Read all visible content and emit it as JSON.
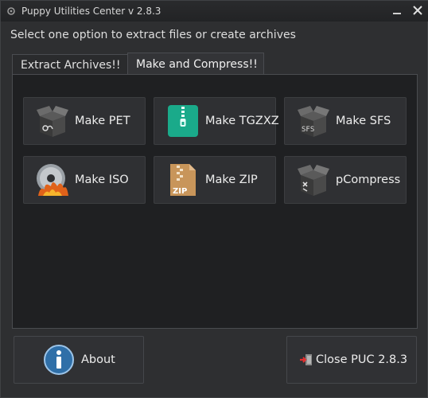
{
  "window": {
    "title": "Puppy Utilities Center v 2.8.3",
    "controls": [
      "minimize-icon",
      "close-icon"
    ]
  },
  "instruction": "Select one option to extract files or create archives",
  "tabs": [
    {
      "label": "Extract Archives!!",
      "active": false
    },
    {
      "label": "Make and Compress!!",
      "active": true
    }
  ],
  "buttons": {
    "make_pet": {
      "label": "Make PET",
      "icon": "box-pet-icon"
    },
    "make_tgzxz": {
      "label": "Make TGZXZ",
      "icon": "green-zip-file-icon"
    },
    "make_sfs": {
      "label": "Make SFS",
      "icon": "box-sfs-icon"
    },
    "make_iso": {
      "label": "Make ISO",
      "icon": "burning-disc-icon"
    },
    "make_zip": {
      "label": "Make ZIP",
      "icon": "zip-archive-icon"
    },
    "pcompress": {
      "label": "pCompress",
      "icon": "box-compress-icon"
    }
  },
  "footer": {
    "about_label": "About",
    "close_label": "Close PUC 2.8.3"
  },
  "colors": {
    "background": "#2e2f31",
    "panel": "#1f2022",
    "button": "#2f3033",
    "text": "#ececec",
    "tgz_green": "#1aaa8a",
    "zip_tan": "#c8955a",
    "info_blue": "#2f6fa8"
  }
}
